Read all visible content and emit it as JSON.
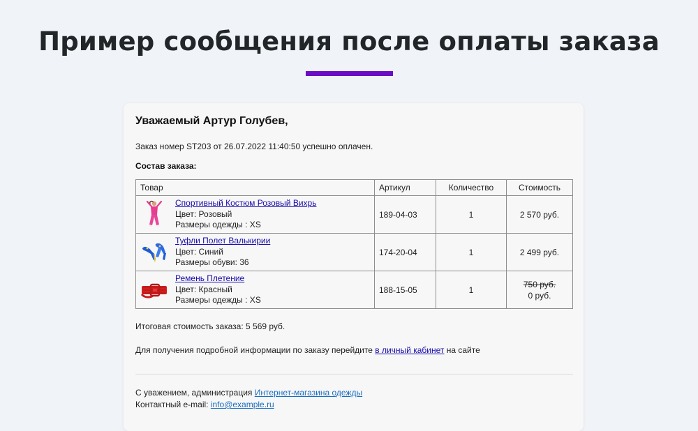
{
  "page": {
    "title": "Пример сообщения после оплаты заказа",
    "accent_color": "#6a0dc4"
  },
  "email": {
    "greeting": "Уважаемый Артур Голубев,",
    "paid_line": "Заказ номер ST203 от 26.07.2022 11:40:50 успешно оплачен.",
    "composition_label": "Состав заказа:",
    "table": {
      "headers": {
        "product": "Товар",
        "article": "Артикул",
        "quantity": "Количество",
        "price": "Стоимость"
      },
      "rows": [
        {
          "name": "Спортивный Костюм Розовый Вихрь",
          "line1": "Цвет: Розовый",
          "line2": "Размеры одежды : XS",
          "article": "189-04-03",
          "quantity": "1",
          "price": "2 570 руб.",
          "thumb_icon": "pink-tracksuit-icon"
        },
        {
          "name": "Туфли Полет Валькирии",
          "line1": "Цвет: Синий",
          "line2": "Размеры обуви: 36",
          "article": "174-20-04",
          "quantity": "1",
          "price": "2 499 руб.",
          "thumb_icon": "blue-shoes-icon"
        },
        {
          "name": "Ремень Плетение",
          "line1": "Цвет: Красный",
          "line2": "Размеры одежды : XS",
          "article": "188-15-05",
          "quantity": "1",
          "old_price": "750 руб.",
          "price": "0 руб.",
          "thumb_icon": "red-belt-icon"
        }
      ]
    },
    "total": "Итоговая стоимость заказа: 5 569 руб.",
    "info_before": "Для получения подробной информации по заказу перейдите ",
    "info_link": "в личный кабинет",
    "info_after": " на сайте",
    "regards_before": "С уважением, администрация ",
    "regards_link": "Интернет-магазина одежды",
    "contact_before": "Контактный e-mail: ",
    "contact_link": "info@example.ru"
  }
}
